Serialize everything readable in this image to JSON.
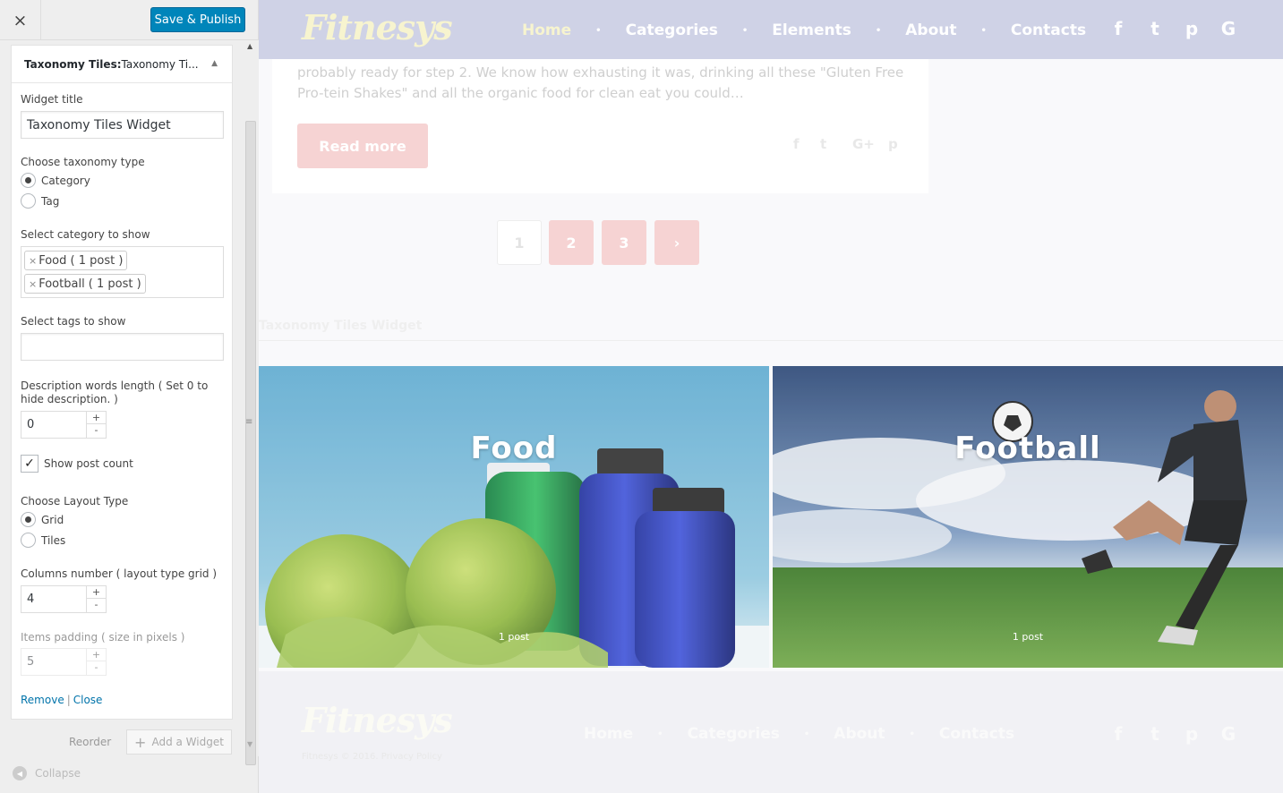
{
  "customizer": {
    "close_icon": "×",
    "save_label": "Save & Publish",
    "widget": {
      "head_bold": "Taxonomy Tiles:",
      "head_rest": " Taxonomy Ti...",
      "title_label": "Widget title",
      "title_value": "Taxonomy Tiles Widget",
      "taxonomy_label": "Choose taxonomy type",
      "taxonomy_options": [
        "Category",
        "Tag"
      ],
      "taxonomy_selected": "Category",
      "category_label": "Select category to show",
      "category_chips": [
        "Food ( 1 post )",
        "Football ( 1 post )"
      ],
      "tags_label": "Select tags to show",
      "tags_value": "",
      "desc_label": "Description words length ( Set 0 to hide description. )",
      "desc_value": "0",
      "show_count_label": "Show post count",
      "show_count_checked": true,
      "layout_label": "Choose Layout Type",
      "layout_options": [
        "Grid",
        "Tiles"
      ],
      "layout_selected": "Grid",
      "columns_label": "Columns number ( layout type grid )",
      "columns_value": "4",
      "padding_label": "Items padding ( size in pixels )",
      "padding_value": "5",
      "remove_label": "Remove",
      "close_label": "Close"
    },
    "reorder_label": "Reorder",
    "add_widget_label": "Add a Widget",
    "collapse_label": "Collapse"
  },
  "site": {
    "logo": "Fitnesys",
    "nav": [
      "Home",
      "Categories",
      "Elements",
      "About",
      "Contacts"
    ],
    "footer_nav": [
      "Home",
      "Categories",
      "About",
      "Contacts"
    ],
    "social_icons": [
      "facebook-icon",
      "twitter-icon",
      "pinterest-icon",
      "google-icon"
    ],
    "post_excerpt": "probably ready for step 2. We know how exhausting it was, drinking all these \"Gluten Free Pro-tein Shakes\" and all the organic food for clean eat you could…",
    "read_more": "Read more",
    "pagination": [
      "1",
      "2",
      "3",
      "›"
    ],
    "pagination_current": "1",
    "widget_title": "Taxonomy Tiles Widget",
    "tiles": [
      {
        "name": "Food",
        "count": "1 post"
      },
      {
        "name": "Football",
        "count": "1 post"
      }
    ],
    "footer_copy": "Fitnesys © 2016. Privacy Policy",
    "accent_color": "#f6d3d3",
    "button_color": "#0085ba"
  }
}
